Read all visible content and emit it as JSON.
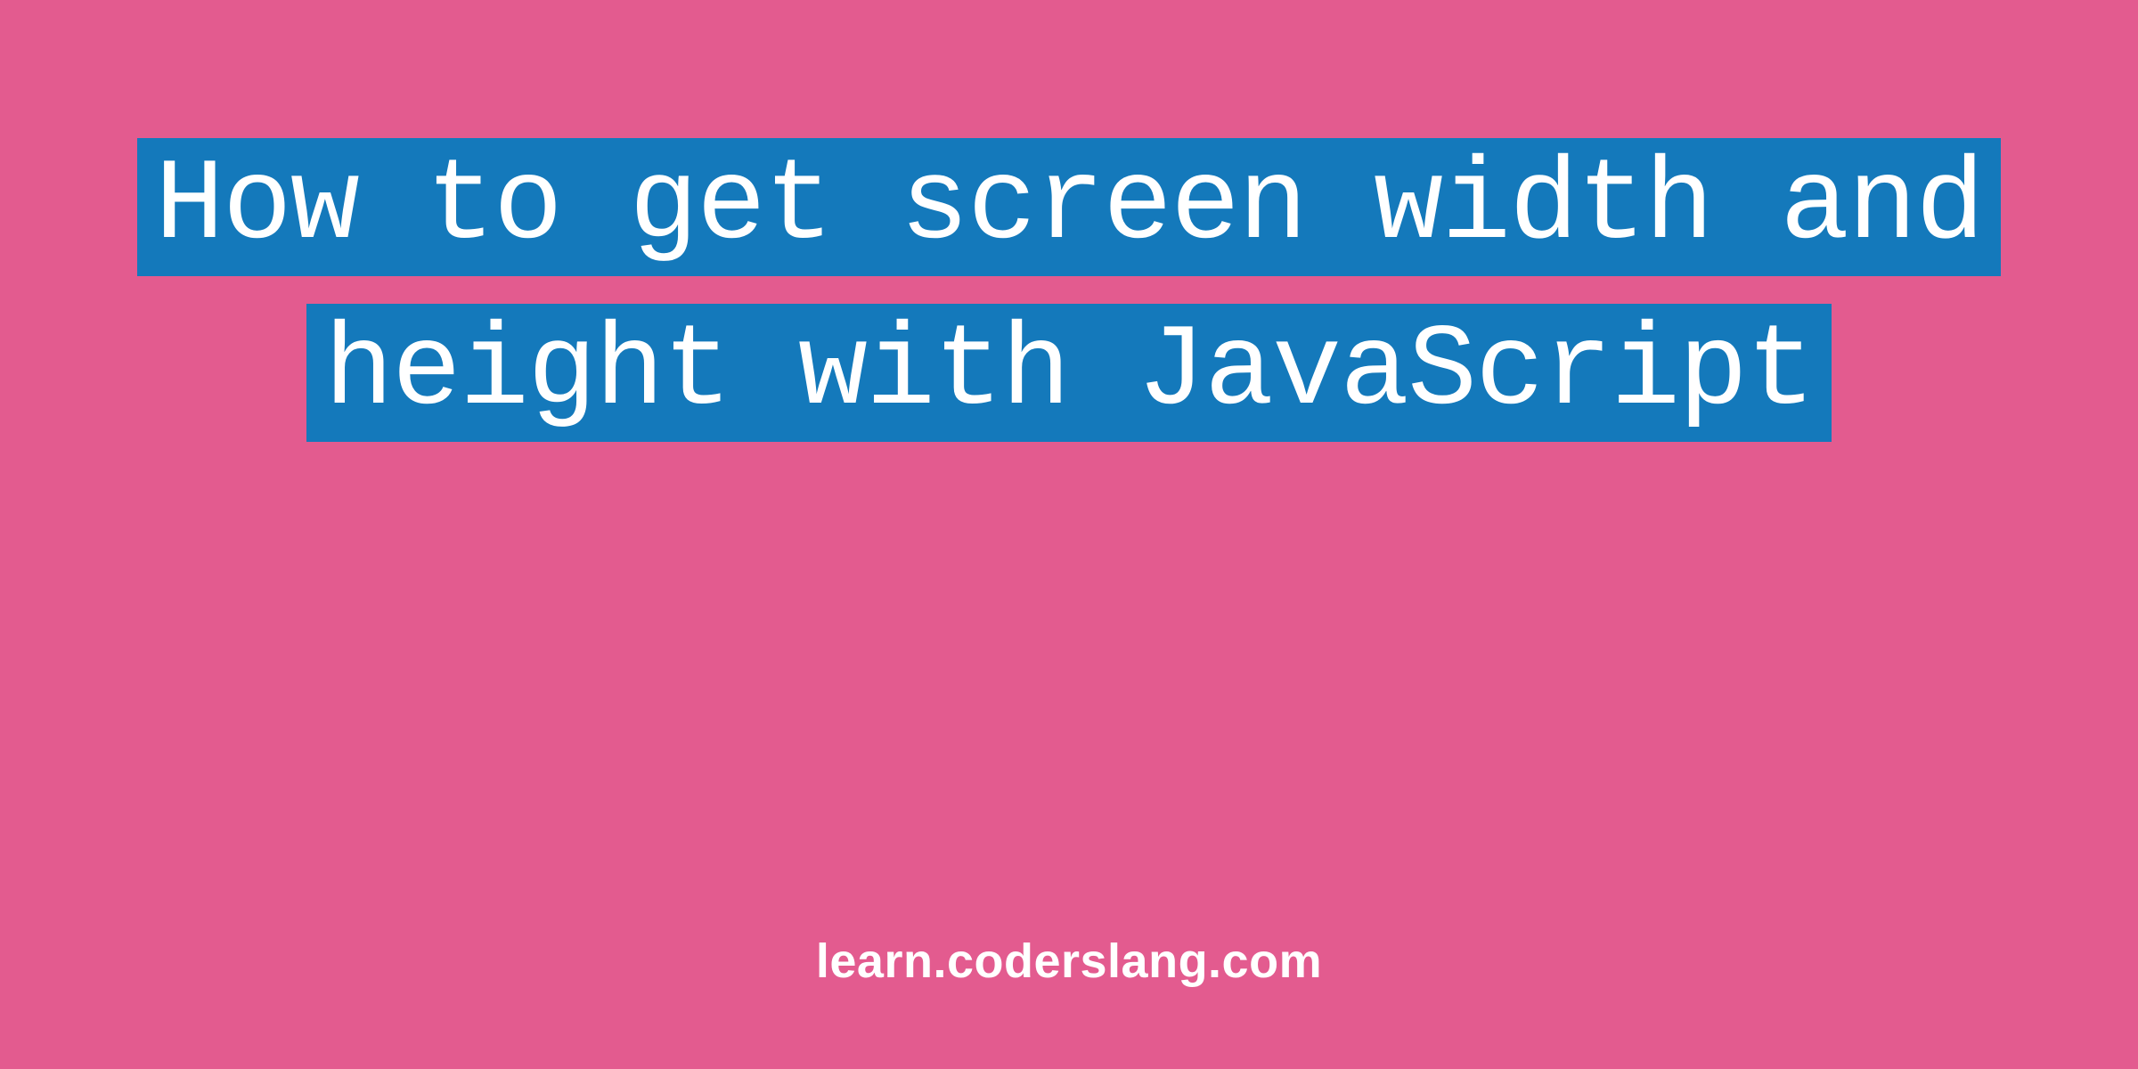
{
  "title": "How to get screen width and height with JavaScript",
  "footer": "learn.coderslang.com",
  "colors": {
    "background": "#e35b8f",
    "highlight": "#1479bb",
    "text": "#ffffff"
  }
}
